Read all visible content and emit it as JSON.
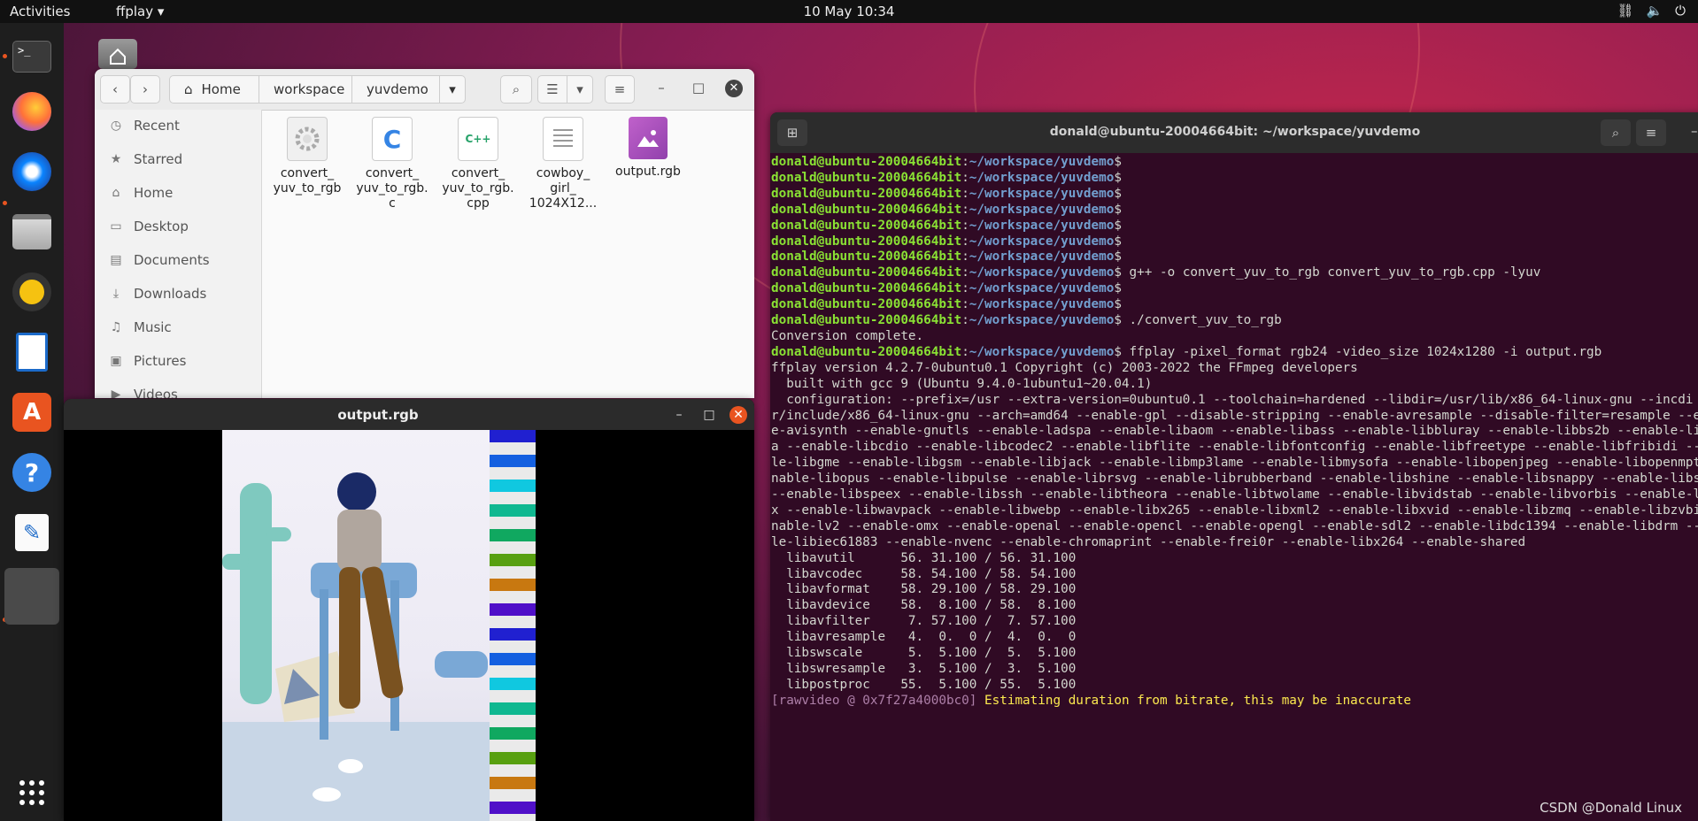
{
  "topbar": {
    "activities": "Activities",
    "app_menu": "ffplay ▾",
    "clock": "10 May  10:34",
    "tray": [
      "network-icon",
      "volume-icon",
      "power-icon"
    ]
  },
  "dock": {
    "items": [
      "terminal-icon",
      "firefox-icon",
      "thunderbird-icon",
      "files-icon",
      "rhythmbox-icon",
      "writer-icon",
      "software-icon",
      "help-icon",
      "text-editor-icon",
      "ffplay-icon"
    ],
    "show_apps": "show-apps-icon"
  },
  "files": {
    "breadcrumb": [
      "Home",
      "workspace",
      "yuvdemo"
    ],
    "sidebar": [
      "Recent",
      "Starred",
      "Home",
      "Desktop",
      "Documents",
      "Downloads",
      "Music",
      "Pictures",
      "Videos"
    ],
    "items": [
      {
        "name": "convert_\nyuv_to_rgb"
      },
      {
        "name": "convert_\nyuv_to_rgb.\nc"
      },
      {
        "name": "convert_\nyuv_to_rgb.\ncpp"
      },
      {
        "name": "cowboy_\ngirl_\n1024X12..."
      },
      {
        "name": "output.rgb"
      }
    ]
  },
  "ffplay": {
    "title": "output.rgb"
  },
  "terminal": {
    "title": "donald@ubuntu-20004664bit: ~/workspace/yuvdemo",
    "user": "donald@ubuntu-20004664bit",
    "path": "~/workspace/yuvdemo",
    "lines": [
      {
        "type": "prompt",
        "cmd": ""
      },
      {
        "type": "prompt",
        "cmd": ""
      },
      {
        "type": "prompt",
        "cmd": ""
      },
      {
        "type": "prompt",
        "cmd": ""
      },
      {
        "type": "prompt",
        "cmd": ""
      },
      {
        "type": "prompt",
        "cmd": ""
      },
      {
        "type": "prompt",
        "cmd": ""
      },
      {
        "type": "prompt",
        "cmd": " g++ -o convert_yuv_to_rgb convert_yuv_to_rgb.cpp -lyuv"
      },
      {
        "type": "prompt",
        "cmd": ""
      },
      {
        "type": "prompt",
        "cmd": ""
      },
      {
        "type": "prompt",
        "cmd": " ./convert_yuv_to_rgb"
      },
      {
        "type": "out",
        "text": "Conversion complete."
      },
      {
        "type": "prompt",
        "cmd": " ffplay -pixel_format rgb24 -video_size 1024x1280 -i output.rgb"
      },
      {
        "type": "out",
        "text": "ffplay version 4.2.7-0ubuntu0.1 Copyright (c) 2003-2022 the FFmpeg developers"
      },
      {
        "type": "out",
        "text": "  built with gcc 9 (Ubuntu 9.4.0-1ubuntu1~20.04.1)"
      },
      {
        "type": "out",
        "text": "  configuration: --prefix=/usr --extra-version=0ubuntu0.1 --toolchain=hardened --libdir=/usr/lib/x86_64-linux-gnu --incdi"
      },
      {
        "type": "out",
        "text": "r/include/x86_64-linux-gnu --arch=amd64 --enable-gpl --disable-stripping --enable-avresample --disable-filter=resample --e"
      },
      {
        "type": "out",
        "text": "e-avisynth --enable-gnutls --enable-ladspa --enable-libaom --enable-libass --enable-libbluray --enable-libbs2b --enable-li"
      },
      {
        "type": "out",
        "text": "a --enable-libcdio --enable-libcodec2 --enable-libflite --enable-libfontconfig --enable-libfreetype --enable-libfribidi --e"
      },
      {
        "type": "out",
        "text": "le-libgme --enable-libgsm --enable-libjack --enable-libmp3lame --enable-libmysofa --enable-libopenjpeg --enable-libopenmpt"
      },
      {
        "type": "out",
        "text": "nable-libopus --enable-libpulse --enable-librsvg --enable-librubberband --enable-libshine --enable-libsnappy --enable-libso"
      },
      {
        "type": "out",
        "text": "--enable-libspeex --enable-libssh --enable-libtheora --enable-libtwolame --enable-libvidstab --enable-libvorbis --enable-li"
      },
      {
        "type": "out",
        "text": "x --enable-libwavpack --enable-libwebp --enable-libx265 --enable-libxml2 --enable-libxvid --enable-libzmq --enable-libzvbi"
      },
      {
        "type": "out",
        "text": "nable-lv2 --enable-omx --enable-openal --enable-opencl --enable-opengl --enable-sdl2 --enable-libdc1394 --enable-libdrm --"
      },
      {
        "type": "out",
        "text": "le-libiec61883 --enable-nvenc --enable-chromaprint --enable-frei0r --enable-libx264 --enable-shared"
      },
      {
        "type": "out",
        "text": "  libavutil      56. 31.100 / 56. 31.100"
      },
      {
        "type": "out",
        "text": "  libavcodec     58. 54.100 / 58. 54.100"
      },
      {
        "type": "out",
        "text": "  libavformat    58. 29.100 / 58. 29.100"
      },
      {
        "type": "out",
        "text": "  libavdevice    58.  8.100 / 58.  8.100"
      },
      {
        "type": "out",
        "text": "  libavfilter     7. 57.100 /  7. 57.100"
      },
      {
        "type": "out",
        "text": "  libavresample   4.  0.  0 /  4.  0.  0"
      },
      {
        "type": "out",
        "text": "  libswscale      5.  5.100 /  5.  5.100"
      },
      {
        "type": "out",
        "text": "  libswresample   3.  5.100 /  3.  5.100"
      },
      {
        "type": "out",
        "text": "  libpostproc    55.  5.100 / 55.  5.100"
      },
      {
        "type": "warn",
        "tag": "[rawvideo @ 0x7f27a4000bc0]",
        "text": " Estimating duration from bitrate, this may be inaccurate"
      }
    ]
  },
  "watermark": "CSDN @Donald Linux",
  "colors": {
    "ubuntu_orange": "#e95420",
    "terminal_bg": "#300a24",
    "prompt_user": "#8ae234",
    "prompt_path": "#729fcf"
  }
}
